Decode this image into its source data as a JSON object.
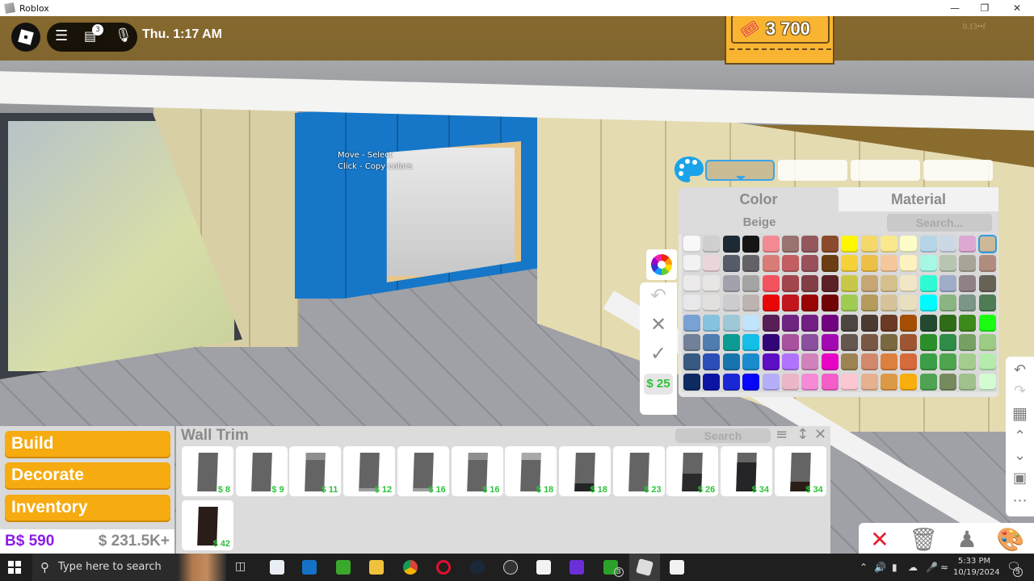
{
  "window": {
    "title": "Roblox",
    "controls": [
      "minimize",
      "maximize",
      "close"
    ]
  },
  "hud": {
    "chat_badge": "3",
    "time": "Thu. 1:17 AM",
    "tickets": "3 700",
    "fps_readout": "0.13••f"
  },
  "tooltip": {
    "line1": "Move - Select",
    "line2": "Click - Copy colors"
  },
  "color_panel": {
    "tabs": [
      "Color",
      "Material"
    ],
    "active_tab": "Color",
    "selected_color_name": "Beige",
    "search_placeholder": "Search...",
    "price": "$ 25",
    "colors": [
      [
        "#f8f8f8",
        "#cfcfcf",
        "#1e2a33",
        "#151515",
        "#f28a92",
        "#987370",
        "#94585c",
        "#8b4a2b",
        "#fff700",
        "#f4d86a",
        "#fae88c",
        "#fdfdc8",
        "#b6d6e8",
        "#cdd8e6",
        "#dda8d2",
        "#cdb99a"
      ],
      [
        "#f2f2f2",
        "#ead5d8",
        "#575a68",
        "#636266",
        "#d77c77",
        "#c25e62",
        "#99505a",
        "#6a3e12",
        "#f5d13a",
        "#edbf44",
        "#f6c79a",
        "#fdf2c0",
        "#a6f7e3",
        "#b8c5b1",
        "#a8a598",
        "#b08c7e"
      ],
      [
        "#eceaea",
        "#e8e6e4",
        "#a3a2ac",
        "#a5a4a4",
        "#f2535e",
        "#a3454c",
        "#813e45",
        "#5a2127",
        "#c8c848",
        "#c6a774",
        "#d4c08c",
        "#f3e6c6",
        "#2efbd4",
        "#9fadc8",
        "#8f8186",
        "#666256"
      ],
      [
        "#e8e8ea",
        "#e2e0de",
        "#cbcbd0",
        "#bdb4b2",
        "#e80707",
        "#c2161e",
        "#990505",
        "#700404",
        "#9fcb52",
        "#b59b5c",
        "#d6c399",
        "#e8dfbf",
        "#00fbff",
        "#8ab582",
        "#7a9686",
        "#4e7c55"
      ],
      [
        "#78a1d4",
        "#85c2de",
        "#9ec8d8",
        "#c1e3fb",
        "#571f55",
        "#6d2581",
        "#721f85",
        "#71037f",
        "#4d4540",
        "#4a3a32",
        "#6a3a24",
        "#a44f05",
        "#234a2e",
        "#2f6c1a",
        "#3d8a1c",
        "#1afd13"
      ],
      [
        "#738099",
        "#4f7db0",
        "#0b9b94",
        "#13bfe6",
        "#330678",
        "#a8519e",
        "#8b4f9f",
        "#a309b1",
        "#64554e",
        "#7a5645",
        "#7a693f",
        "#9e5632",
        "#2c8e2a",
        "#2e8c47",
        "#77a163",
        "#9ccb84"
      ],
      [
        "#375982",
        "#2c4eb8",
        "#1775ae",
        "#1a8ccd",
        "#5e0ec3",
        "#b173fb",
        "#d182bd",
        "#e802c6",
        "#9c8352",
        "#d2886a",
        "#dc803f",
        "#d56a3c",
        "#3c9e46",
        "#4ea54e",
        "#a3cc8e",
        "#b5ecae"
      ],
      [
        "#0d2a63",
        "#0a16a3",
        "#1a27d4",
        "#0707f7",
        "#b5aef9",
        "#ebb7c8",
        "#f58ad9",
        "#f45fc7",
        "#fcc6d2",
        "#e6b18e",
        "#dc9a46",
        "#f8ae0d",
        "#4fa353",
        "#768a5e",
        "#a0c08e",
        "#d4fcd3"
      ]
    ],
    "selected_index": [
      0,
      15
    ]
  },
  "left_menu": {
    "buttons": [
      "Build",
      "Decorate",
      "Inventory"
    ],
    "bucks": "B$ 590",
    "cash": "$ 231.5K+"
  },
  "catalog": {
    "title": "Wall Trim",
    "search_placeholder": "Search",
    "items": [
      {
        "price": "$ 8",
        "top": "#646464",
        "band": "none"
      },
      {
        "price": "$ 9",
        "top": "#646464",
        "band": "none"
      },
      {
        "price": "$ 11",
        "top": "#8f8f8f",
        "band": "top"
      },
      {
        "price": "$ 12",
        "top": "#646464",
        "band": "bottom-light"
      },
      {
        "price": "$ 16",
        "top": "#646464",
        "band": "bottom-light"
      },
      {
        "price": "$ 16",
        "top": "#8f8f8f",
        "band": "top"
      },
      {
        "price": "$ 18",
        "top": "#a9a9a9",
        "band": "top"
      },
      {
        "price": "$ 18",
        "top": "#646464",
        "band": "bottom-dark"
      },
      {
        "price": "$ 23",
        "top": "#646464",
        "band": "none"
      },
      {
        "price": "$ 26",
        "top": "#646464",
        "band": "half-dark"
      },
      {
        "price": "$ 34",
        "top": "#646464",
        "band": "mostly-dark"
      },
      {
        "price": "$ 34",
        "top": "#646464",
        "band": "bottom-brown"
      },
      {
        "price": "$ 42",
        "top": "#2a1d17",
        "band": "none"
      }
    ]
  },
  "taskbar": {
    "search_placeholder": "Type here to search",
    "xbox_badge": "3",
    "clock_time": "5:33 PM",
    "clock_date": "10/19/2024",
    "notification_badge": "3"
  }
}
